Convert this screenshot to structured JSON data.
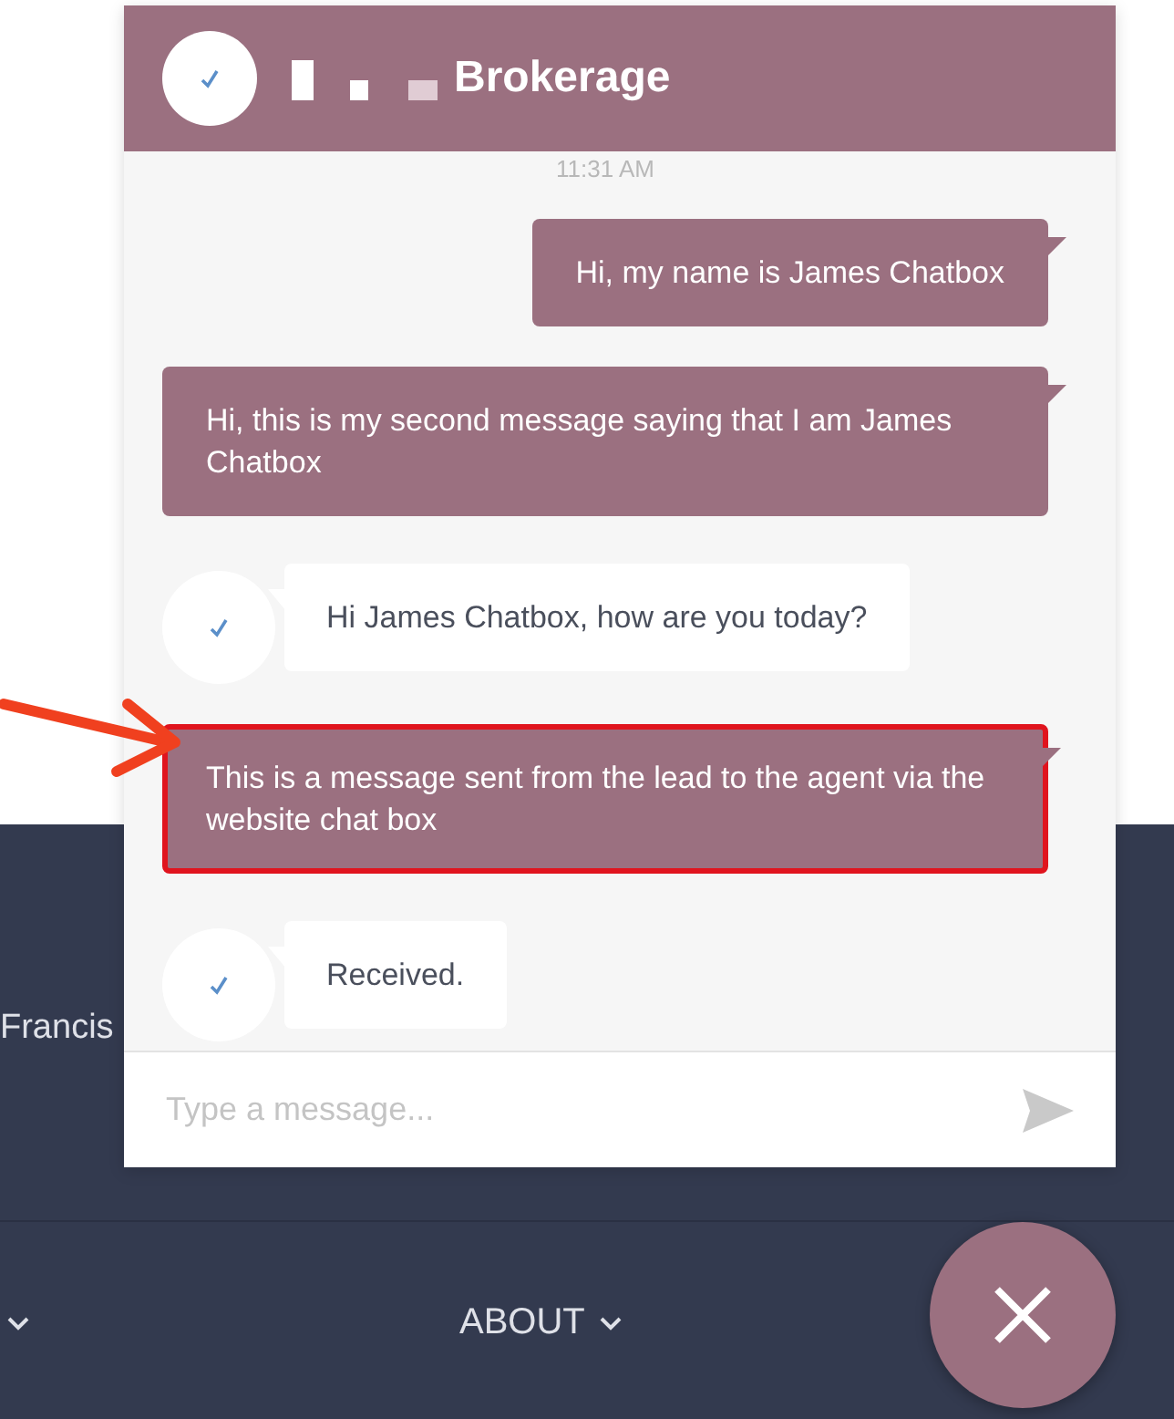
{
  "chat": {
    "header": {
      "title": "Brokerage"
    },
    "timestamp": "11:31 AM",
    "messages": [
      {
        "kind": "sent",
        "text": "Hi, my name is James Chatbox",
        "highlighted": false
      },
      {
        "kind": "sent",
        "text": "Hi, this is my second message saying that I am James Chatbox",
        "highlighted": false
      },
      {
        "kind": "received",
        "text": "Hi James Chatbox, how are you today?",
        "highlighted": false
      },
      {
        "kind": "sent",
        "text": "This is a message sent from the lead to the agent via the website chat box",
        "highlighted": true
      },
      {
        "kind": "received",
        "text": "Received.",
        "highlighted": false
      }
    ],
    "input": {
      "placeholder": "Type a message..."
    }
  },
  "footer": {
    "location": "Francis",
    "nav": [
      {
        "label": "ABOUT"
      }
    ]
  }
}
